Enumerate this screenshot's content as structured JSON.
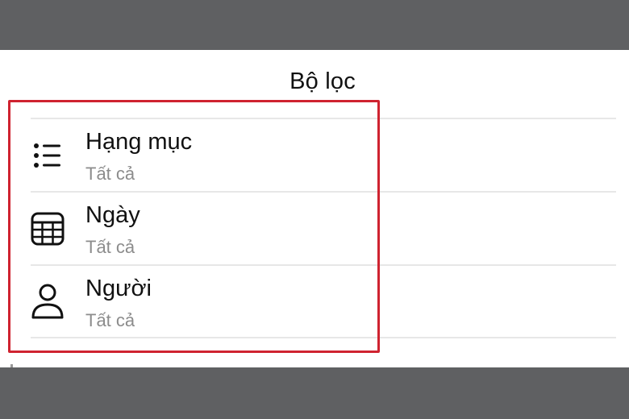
{
  "header": {
    "title": "Bộ lọc"
  },
  "filters": [
    {
      "label": "Hạng mục",
      "value": "Tất cả",
      "icon": "list-icon"
    },
    {
      "label": "Ngày",
      "value": "Tất cả",
      "icon": "calendar-icon"
    },
    {
      "label": "Người",
      "value": "Tất cả",
      "icon": "person-icon"
    }
  ],
  "colors": {
    "highlight": "#cf2330",
    "background": "#5f6062",
    "subtext": "#8c8c8c"
  }
}
